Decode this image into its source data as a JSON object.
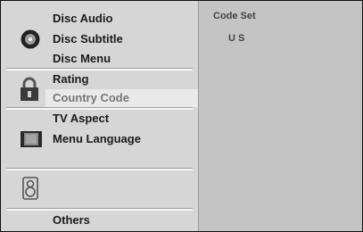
{
  "menu": {
    "disc_group": {
      "icon": "disc-icon",
      "items": [
        "Disc Audio",
        "Disc Subtitle",
        "Disc Menu"
      ]
    },
    "lock_group": {
      "icon": "padlock-icon",
      "items": [
        "Rating",
        "Country Code"
      ],
      "selected": "Country Code"
    },
    "display_group": {
      "icon": "tv-screen-icon",
      "items": [
        "TV Aspect",
        "Menu Language"
      ]
    },
    "audio_group": {
      "icon": "speaker-icon"
    },
    "others_group": {
      "items": [
        "Others"
      ]
    }
  },
  "panel": {
    "heading": "Code Set",
    "value": "U S"
  }
}
